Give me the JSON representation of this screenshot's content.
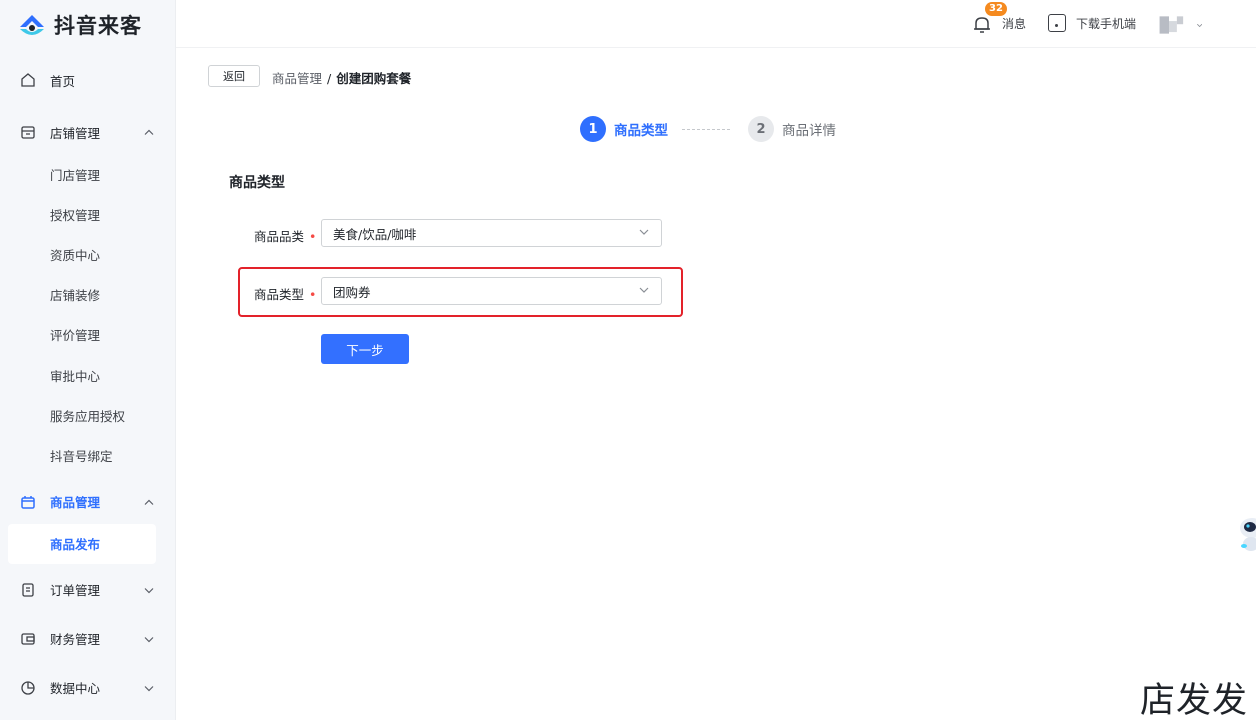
{
  "app": {
    "name": "抖音来客"
  },
  "header": {
    "notification_count": "32",
    "messages_label": "消息",
    "download_label": "下载手机端"
  },
  "sidebar": {
    "home": "首页",
    "store_mgmt": {
      "label": "店铺管理",
      "items": [
        "门店管理",
        "授权管理",
        "资质中心",
        "店铺装修",
        "评价管理",
        "审批中心",
        "服务应用授权",
        "抖音号绑定"
      ]
    },
    "product_mgmt": {
      "label": "商品管理",
      "items": [
        "商品发布"
      ]
    },
    "order_mgmt": "订单管理",
    "finance_mgmt": "财务管理",
    "data_center": "数据中心"
  },
  "breadcrumb": {
    "back": "返回",
    "parent": "商品管理",
    "separator": "/",
    "current": "创建团购套餐"
  },
  "steps": [
    {
      "num": "1",
      "label": "商品类型",
      "active": true
    },
    {
      "num": "2",
      "label": "商品详情",
      "active": false
    }
  ],
  "form": {
    "section_title": "商品类型",
    "category": {
      "label": "商品品类",
      "value": "美食/饮品/咖啡"
    },
    "type": {
      "label": "商品类型",
      "value": "团购券"
    },
    "required_mark": "•",
    "next_button": "下一步"
  },
  "footer_mark": "店发发",
  "colors": {
    "accent": "#2f6ffe",
    "highlight": "#e3222a",
    "badge": "#f58a1f"
  }
}
